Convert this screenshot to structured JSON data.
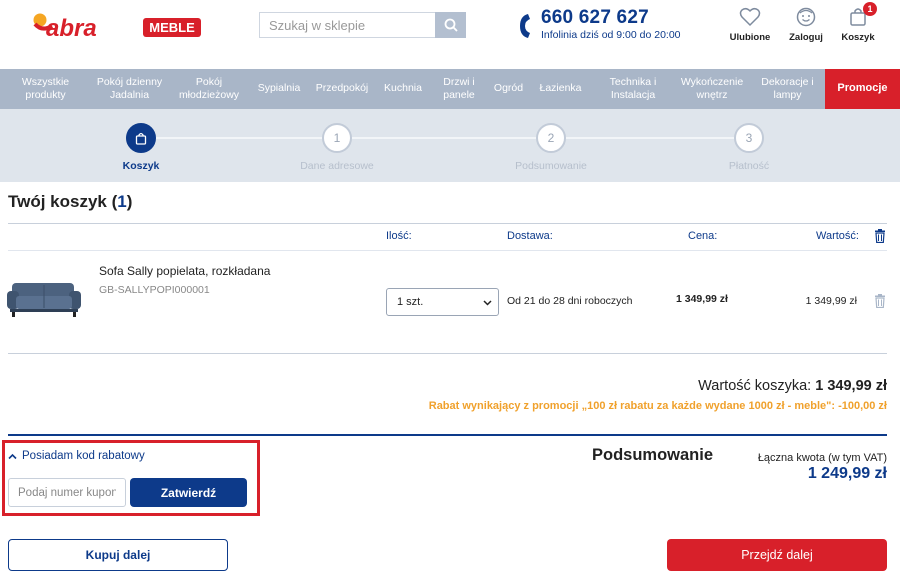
{
  "header": {
    "logo_text": "abra",
    "logo_badge": "MEBLE",
    "search_placeholder": "Szukaj w sklepie",
    "phone": "660 627 627",
    "phone_info": "Infolinia dziś od 9:00 do 20:00",
    "favorites_label": "Ulubione",
    "login_label": "Zaloguj",
    "cart_label": "Koszyk",
    "cart_count": "1",
    "icons": [
      "search-icon",
      "phone-icon",
      "heart-icon",
      "user-face-icon",
      "shopping-bag-icon"
    ]
  },
  "nav": {
    "items": [
      {
        "label": "Wszystkie produkty"
      },
      {
        "label": "Pokój dzienny Jadalnia"
      },
      {
        "label": "Pokój młodzieżowy"
      },
      {
        "label": "Sypialnia"
      },
      {
        "label": "Przedpokój"
      },
      {
        "label": "Kuchnia"
      },
      {
        "label": "Drzwi i panele"
      },
      {
        "label": "Ogród"
      },
      {
        "label": "Łazienka"
      },
      {
        "label": "Technika i Instalacja"
      },
      {
        "label": "Wykończenie wnętrz"
      },
      {
        "label": "Dekoracje i lampy"
      },
      {
        "label": "Promocje"
      }
    ]
  },
  "steps": [
    {
      "number": "",
      "label": "Koszyk",
      "active": true
    },
    {
      "number": "1",
      "label": "Dane adresowe",
      "active": false
    },
    {
      "number": "2",
      "label": "Podsumowanie",
      "active": false
    },
    {
      "number": "3",
      "label": "Płatność",
      "active": false
    }
  ],
  "cart": {
    "title": "Twój koszyk",
    "count": "1",
    "columns": {
      "qty": "Ilość:",
      "delivery": "Dostawa:",
      "price": "Cena:",
      "value": "Wartość:"
    },
    "items": [
      {
        "name": "Sofa Sally popielata, rozkładana",
        "sku": "GB-SALLYPOPI000001",
        "qty": "1 szt.",
        "delivery": "Od 21 do 28 dni roboczych",
        "price": "1 349,99 zł",
        "value": "1 349,99 zł"
      }
    ],
    "total_label": "Wartość koszyka:",
    "total_value": "1 349,99 zł",
    "promo_text": "Rabat wynikający z promocji „100 zł rabatu za każde wydane 1000 zł - meble\": -100,00 zł"
  },
  "coupon": {
    "toggle_label": "Posiadam kod rabatowy",
    "placeholder": "Podaj numer kuponu",
    "submit_label": "Zatwierdź"
  },
  "summary": {
    "title": "Podsumowanie",
    "total_label": "Łączna kwota (w tym VAT)",
    "total_value": "1 249,99 zł"
  },
  "actions": {
    "continue_label": "Kupuj dalej",
    "next_label": "Przejdź dalej"
  },
  "colors": {
    "brand_blue": "#0d3a8a",
    "brand_red": "#d8202a",
    "nav_bg": "#a9b6c8",
    "promo_orange": "#f0a12c"
  }
}
